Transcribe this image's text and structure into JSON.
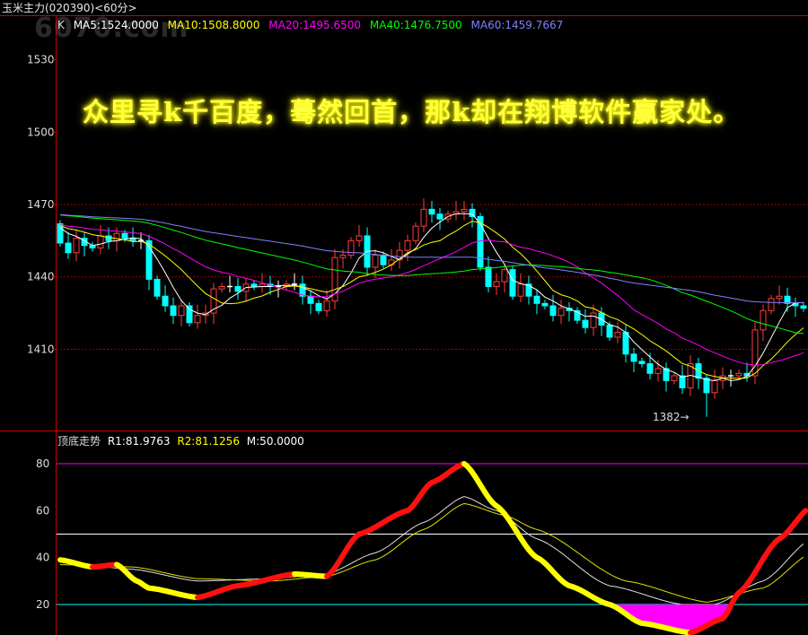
{
  "header": {
    "title": "玉米主力(020390)<60分>",
    "watermark": "6070.com"
  },
  "main_legend": {
    "k": "K",
    "ma5": "MA5:1524.0000",
    "ma10": "MA10:1508.8000",
    "ma20": "MA20:1495.6500",
    "ma40": "MA40:1476.7500",
    "ma60": "MA60:1459.7667"
  },
  "overlay_text": "众里寻k千百度，蓦然回首，那k却在翔博软件赢家处。",
  "low_marker": "1382→",
  "indicator_legend": {
    "name": "顶底走势",
    "r1": "R1:81.9763",
    "r2": "R2:81.1256",
    "m": "M:50.0000"
  },
  "colors": {
    "up": "#ff3b3b",
    "down": "#00ffff",
    "ma5": "#ffffff",
    "ma10": "#ffff00",
    "ma20": "#ff00ff",
    "ma40": "#00ff00",
    "ma60": "#8080ff",
    "grid": "#a00000"
  },
  "chart_data": [
    {
      "type": "candlestick",
      "y_ticks": [
        "1530",
        "1500",
        "1470",
        "1440",
        "1410"
      ],
      "ylim": [
        1367,
        1541
      ],
      "grid_levels": [
        1470,
        1440,
        1410
      ],
      "closes": [
        1454,
        1450,
        1456,
        1453,
        1452,
        1457,
        1455,
        1458,
        1456,
        1455,
        1455,
        1439,
        1432,
        1428,
        1424,
        1428,
        1421,
        1424,
        1425,
        1435,
        1436,
        1436,
        1434,
        1437,
        1436,
        1437,
        1436,
        1436,
        1437,
        1437,
        1432,
        1429,
        1426,
        1430,
        1448,
        1449,
        1455,
        1457,
        1444,
        1449,
        1445,
        1447,
        1451,
        1455,
        1461,
        1468,
        1466,
        1464,
        1466,
        1467,
        1468,
        1465,
        1444,
        1436,
        1438,
        1443,
        1432,
        1437,
        1432,
        1429,
        1428,
        1424,
        1427,
        1426,
        1422,
        1419,
        1425,
        1420,
        1415,
        1417,
        1408,
        1405,
        1404,
        1400,
        1402,
        1397,
        1399,
        1394,
        1404,
        1398,
        1392,
        1397,
        1399,
        1399,
        1400,
        1399,
        1418,
        1426,
        1431,
        1432,
        1429,
        1428,
        1427
      ],
      "first_open": 1462,
      "low_point": {
        "index": 80,
        "value": 1382
      }
    },
    {
      "type": "line",
      "y_ticks": [
        "80",
        "60",
        "40",
        "20"
      ],
      "ylim": [
        0,
        94
      ],
      "levels": [
        {
          "value": 80,
          "color": "#ff00ff"
        },
        {
          "value": 50,
          "color": "#ffffff"
        },
        {
          "value": 20,
          "color": "#00ffff"
        }
      ],
      "series": [
        {
          "name": "R1",
          "points": [
            [
              0,
              39
            ],
            [
              4,
              36
            ],
            [
              7,
              37
            ],
            [
              9.5,
              30
            ],
            [
              11,
              27
            ],
            [
              17,
              23
            ],
            [
              22,
              28
            ],
            [
              29,
              33
            ],
            [
              33,
              32
            ],
            [
              37,
              50
            ],
            [
              43,
              60
            ],
            [
              46,
              72
            ],
            [
              50,
              80
            ],
            [
              54,
              62
            ],
            [
              59,
              40
            ],
            [
              63,
              28
            ],
            [
              68,
              20
            ],
            [
              72,
              12
            ],
            [
              78,
              8
            ],
            [
              82,
              14
            ],
            [
              84,
              25
            ],
            [
              89,
              48
            ],
            [
              93,
              62
            ]
          ]
        },
        {
          "name": "R2",
          "points": [
            [
              0,
              38
            ],
            [
              9,
              35
            ],
            [
              17,
              30
            ],
            [
              26,
              31
            ],
            [
              33,
              33
            ],
            [
              39,
              42
            ],
            [
              45,
              55
            ],
            [
              50,
              66
            ],
            [
              54,
              60
            ],
            [
              59,
              48
            ],
            [
              68,
              28
            ],
            [
              77,
              20
            ],
            [
              81,
              20
            ],
            [
              87,
              30
            ],
            [
              93,
              48
            ]
          ]
        },
        {
          "name": "R3",
          "points": [
            [
              0,
              37
            ],
            [
              9,
              36
            ],
            [
              17,
              31
            ],
            [
              26,
              30
            ],
            [
              33,
              32
            ],
            [
              39,
              39
            ],
            [
              45,
              52
            ],
            [
              50,
              63
            ],
            [
              55,
              58
            ],
            [
              59,
              52
            ],
            [
              70,
              30
            ],
            [
              80,
              21
            ],
            [
              87,
              27
            ],
            [
              93,
              42
            ]
          ]
        }
      ]
    }
  ]
}
